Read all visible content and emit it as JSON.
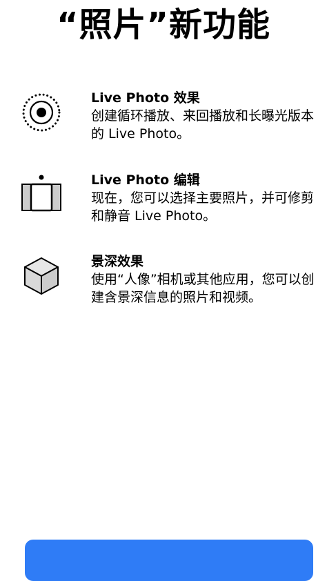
{
  "page_title": "“照片”新功能",
  "features": [
    {
      "icon": "live-photo-effects-icon",
      "title": "Live Photo 效果",
      "description": "创建循环播放、来回播放和长曝光版本的 Live Photo。"
    },
    {
      "icon": "live-photo-edit-icon",
      "title": "Live Photo 编辑",
      "description": "现在，您可以选择主要照片，并可修剪和静音 Live Photo。"
    },
    {
      "icon": "depth-cube-icon",
      "title": "景深效果",
      "description": "使用“人像”相机或其他应用，您可以创建含景深信息的照片和视频。"
    }
  ],
  "colors": {
    "accent": "#2f7cf6",
    "icon_fill": "#cccccc",
    "text": "#000000"
  }
}
